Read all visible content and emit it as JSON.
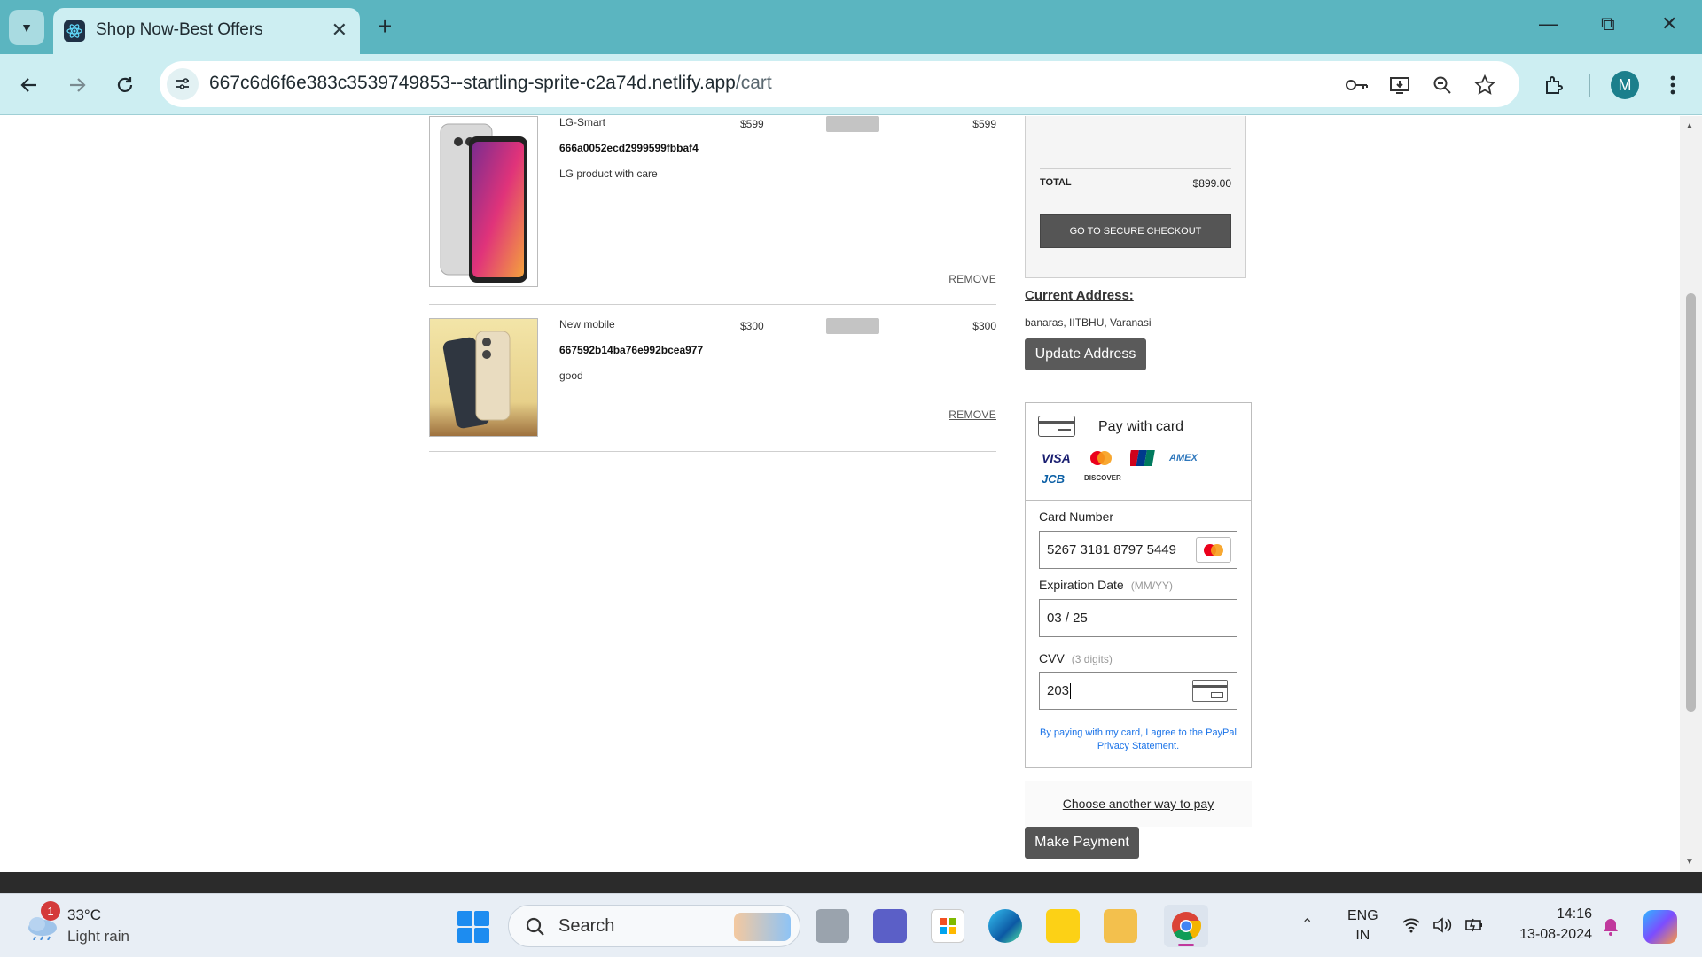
{
  "browser": {
    "tab_title": "Shop Now-Best Offers",
    "url_host": "667c6d6f6e383c3539749853--startling-sprite-c2a74d.netlify.app",
    "url_path": "/cart",
    "profile_initial": "M"
  },
  "cart": {
    "items": [
      {
        "name": "LG-Smart",
        "id": "666a0052ecd2999599fbbaf4",
        "description": "LG product with care",
        "price": "$599",
        "subtotal": "$599",
        "remove": "REMOVE"
      },
      {
        "name": "New mobile",
        "id": "667592b14ba76e992bcea977",
        "description": "good",
        "price": "$300",
        "subtotal": "$300",
        "remove": "REMOVE"
      }
    ]
  },
  "summary": {
    "total_label": "TOTAL",
    "total_value": "$899.00",
    "checkout_label": "GO TO SECURE CHECKOUT"
  },
  "address": {
    "heading": "Current Address:",
    "value": "banaras, IITBHU, Varanasi",
    "update_label": "Update Address"
  },
  "payment": {
    "title": "Pay with card",
    "brands": [
      "VISA",
      "AMEX",
      "JCB",
      "DISCOVER"
    ],
    "card_number_label": "Card Number",
    "card_number_value": "5267 3181 8797 5449",
    "expiry_label": "Expiration Date",
    "expiry_hint": "(MM/YY)",
    "expiry_value": "03 / 25",
    "cvv_label": "CVV",
    "cvv_hint": "(3 digits)",
    "cvv_value": "203",
    "agree_text": "By paying with my card, I agree to the PayPal Privacy Statement.",
    "another_way": "Choose another way to pay",
    "make_payment": "Make Payment"
  },
  "taskbar": {
    "weather_badge": "1",
    "temperature": "33°C",
    "condition": "Light rain",
    "search_label": "Search",
    "lang_top": "ENG",
    "lang_bottom": "IN",
    "time": "14:16",
    "date": "13-08-2024"
  },
  "colors": {
    "tabbar": "#5bb5c0",
    "toolbar": "#cdeef2",
    "button_dark": "#555555",
    "link_blue": "#1a73e8"
  }
}
